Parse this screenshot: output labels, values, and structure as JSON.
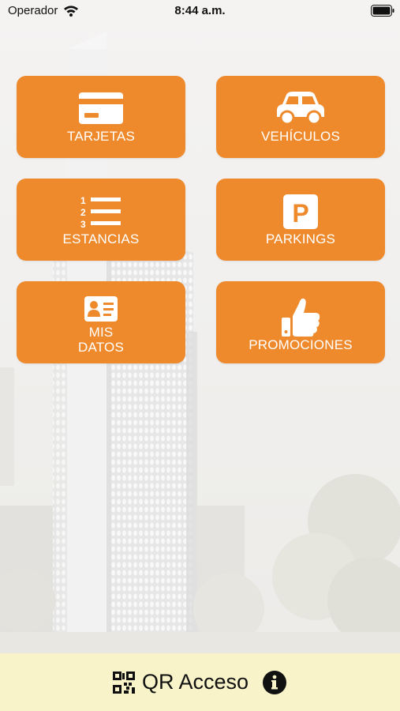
{
  "status_bar": {
    "carrier": "Operador",
    "time": "8:44 a.m."
  },
  "menu": [
    {
      "id": "tarjetas",
      "label": "TARJETAS",
      "icon": "credit-card-icon"
    },
    {
      "id": "vehiculos",
      "label": "VEHÍCULOS",
      "icon": "car-icon"
    },
    {
      "id": "estancias",
      "label": "ESTANCIAS",
      "icon": "numbered-list-icon"
    },
    {
      "id": "parkings",
      "label": "PARKINGS",
      "icon": "parking-sign-icon"
    },
    {
      "id": "mis_datos",
      "label_line1": "MIS",
      "label_line2": "DATOS",
      "icon": "id-card-icon"
    },
    {
      "id": "promociones",
      "label": "PROMOCIONES",
      "icon": "thumbs-up-icon"
    }
  ],
  "bottom_bar": {
    "label": "QR Acceso",
    "icon_left": "qr-code-icon",
    "icon_right": "info-icon"
  },
  "colors": {
    "tile": "#ee8a2c",
    "bottom_bar": "#f8f3c9",
    "tile_text": "#ffffff"
  }
}
